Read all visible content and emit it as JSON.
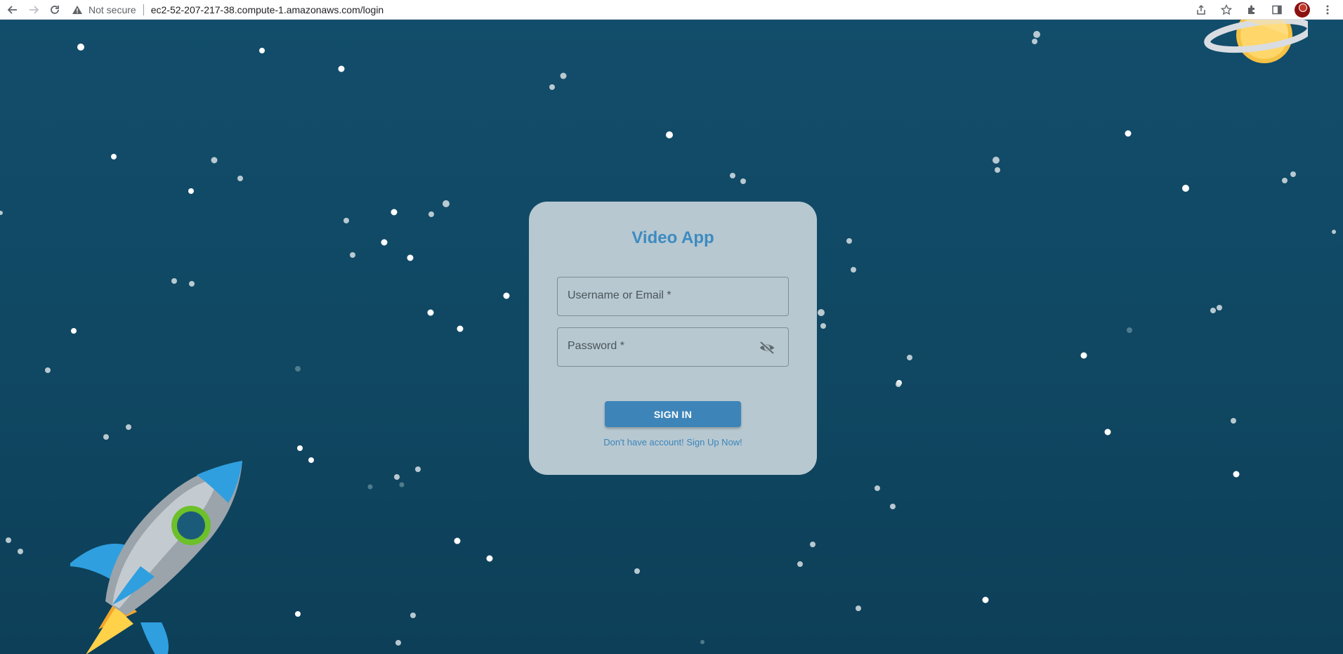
{
  "browser": {
    "security_label": "Not secure",
    "url": "ec2-52-207-217-38.compute-1.amazonaws.com/login"
  },
  "login": {
    "title": "Video App",
    "username_label": "Username or Email *",
    "password_label": "Password *",
    "signin_label": "SIGN IN",
    "signup_link": "Don't have account! Sign Up Now!"
  },
  "colors": {
    "background": "#104863",
    "card": "#b7c8d1",
    "accent": "#3d85b9"
  },
  "icons": [
    "back-icon",
    "forward-icon",
    "reload-icon",
    "warning-icon",
    "share-icon",
    "star-icon",
    "extensions-icon",
    "side-panel-icon",
    "profile-avatar",
    "more-icon",
    "eye-off-icon",
    "planet-icon",
    "rocket-icon"
  ]
}
